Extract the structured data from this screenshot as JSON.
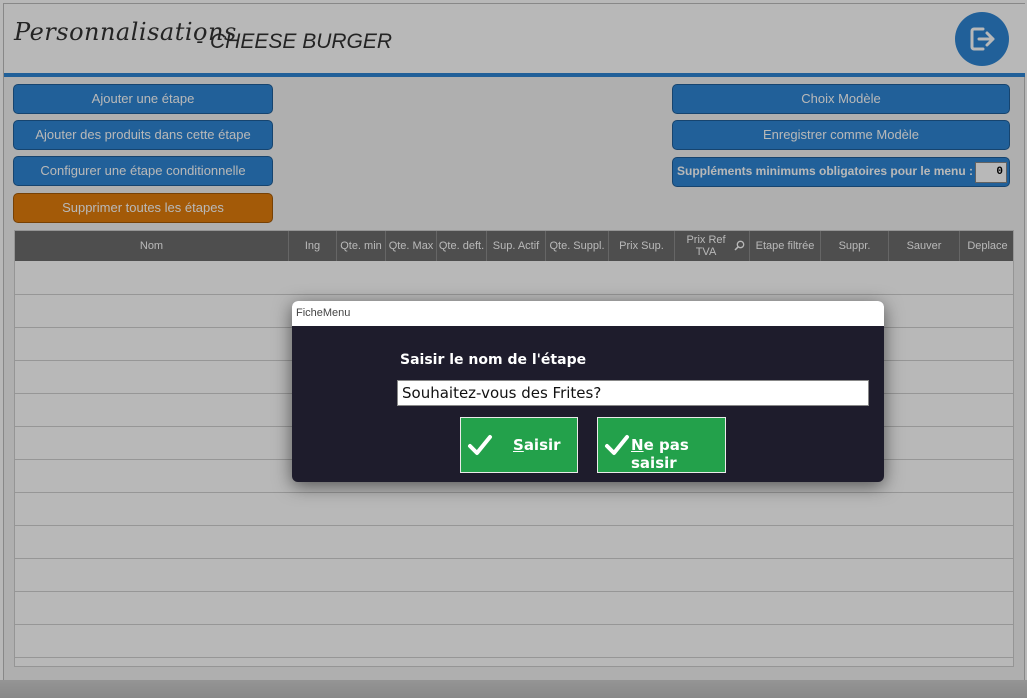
{
  "header": {
    "title": "Personnalisations",
    "separator": "-",
    "product": "CHEESE BURGER",
    "exit_icon": "logout-icon"
  },
  "left_buttons": [
    "Ajouter une étape",
    "Ajouter des produits dans cette étape",
    "Configurer une étape conditionnelle",
    "Supprimer toutes les étapes"
  ],
  "right_buttons": {
    "choose_model": "Choix Modèle",
    "save_model": "Enregistrer comme Modèle",
    "supplements_label": "Suppléments minimums obligatoires pour le menu :",
    "supplements_value": "0"
  },
  "table": {
    "columns": [
      "Nom",
      "Ing",
      "Qte. min",
      "Qte. Max",
      "Qte. deft.",
      "Sup. Actif",
      "Qte. Suppl.",
      "Prix Sup.",
      "Prix Ref TVA",
      "Etape filtrée",
      "Suppr.",
      "Sauver",
      "Deplace"
    ],
    "rows": []
  },
  "dialog": {
    "title": "FicheMenu",
    "prompt": "Saisir le nom de l'étape",
    "input_value": "Souhaitez-vous des Frites?",
    "ok_first": "S",
    "ok_rest": "aisir",
    "cancel_first": "N",
    "cancel_rest": "e pas saisir"
  },
  "colors": {
    "accent_blue": "#2e86d4",
    "danger_orange": "#e27d0c",
    "confirm_green": "#23a14b",
    "dialog_bg": "#1e1c2c"
  }
}
